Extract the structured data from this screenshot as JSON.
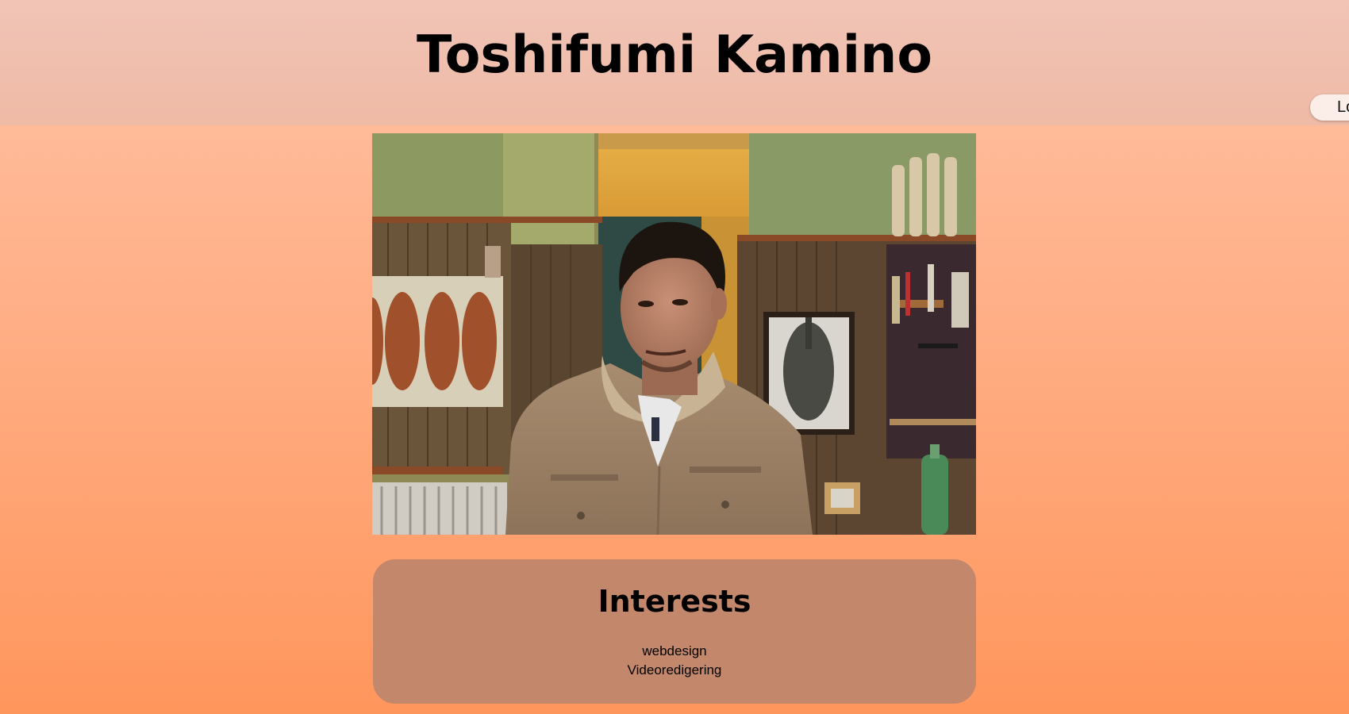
{
  "header": {
    "title": "Toshifumi Kamino",
    "button_label": "Lo"
  },
  "photo": {
    "subject": "person-photo"
  },
  "interests": {
    "heading": "Interests",
    "items": [
      "webdesign",
      "Videoredigering"
    ]
  },
  "colors": {
    "header_bg": "#efbfae",
    "page_gradient_top": "#ffc2a4",
    "page_gradient_bottom": "#ff965c",
    "card_bg": "#c3876b",
    "button_bg": "#fbeee8"
  }
}
